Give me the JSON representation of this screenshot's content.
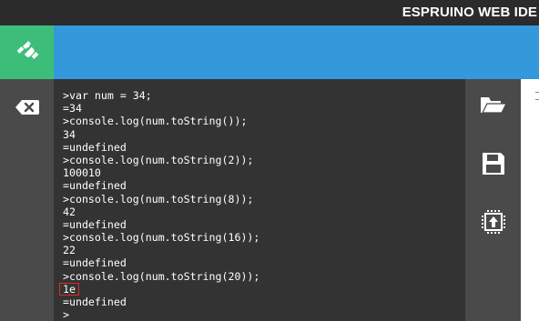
{
  "app": {
    "title": "ESPRUINO WEB IDE"
  },
  "colors": {
    "connect_bg": "#3cbe7a",
    "toolbar_bg": "#3498db",
    "terminal_bg": "#333333",
    "sidebar_bg": "#4a4a4a",
    "highlight_border": "#e02a2a"
  },
  "icons": {
    "connect": "plug-disconnected-icon",
    "clear": "backspace-clear-icon",
    "open": "folder-open-icon",
    "save": "floppy-save-icon",
    "upload": "upload-to-board-icon"
  },
  "terminal": {
    "lines": [
      ">var num = 34;",
      "=34",
      ">console.log(num.toString());",
      "34",
      "=undefined",
      ">console.log(num.toString(2));",
      "100010",
      "=undefined",
      ">console.log(num.toString(8));",
      "42",
      "=undefined",
      ">console.log(num.toString(16));",
      "22",
      "=undefined",
      ">console.log(num.toString(20));",
      "1e",
      "=undefined",
      ">"
    ],
    "highlighted_line": 15
  }
}
